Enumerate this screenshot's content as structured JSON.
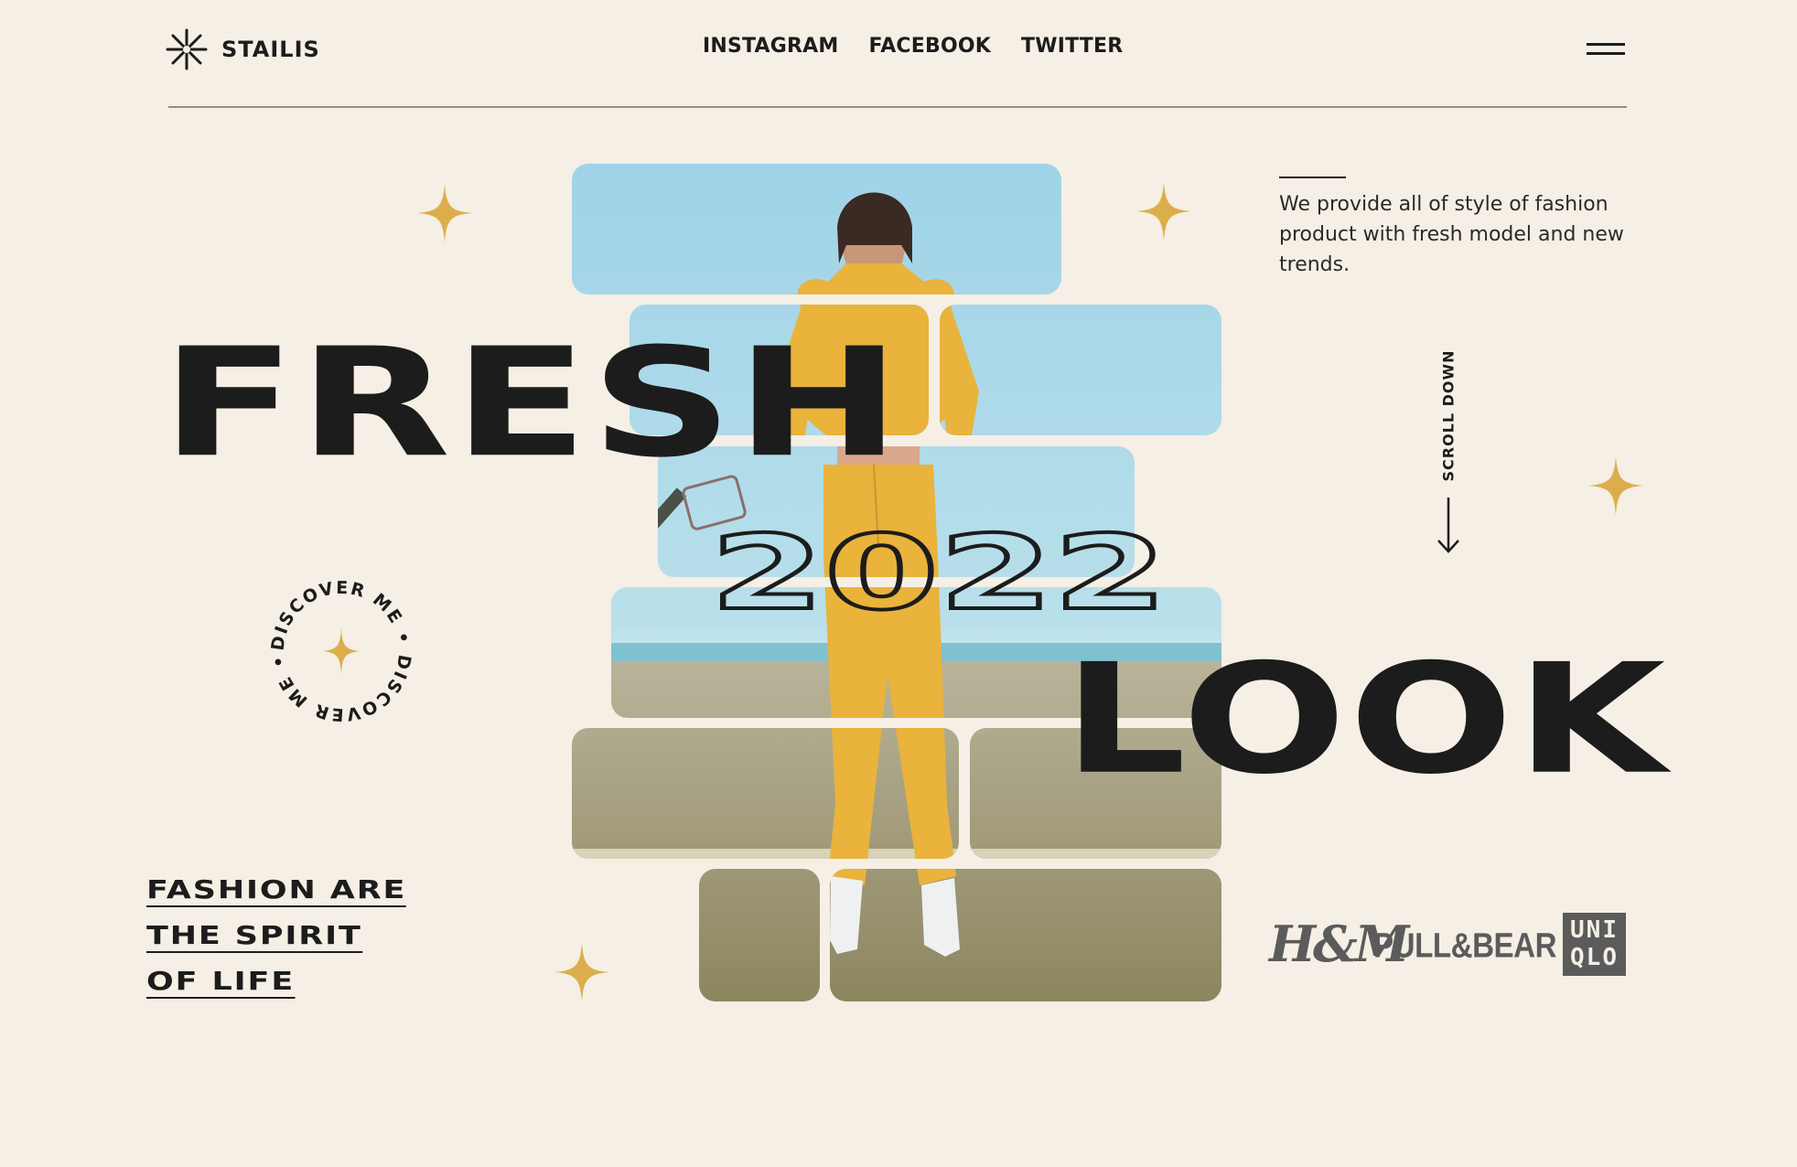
{
  "header": {
    "brand": "STAILIS",
    "nav": [
      "INSTAGRAM",
      "FACEBOOK",
      "TWITTER"
    ]
  },
  "hero": {
    "word1": "FRESH",
    "year": "2022",
    "word2": "LOOK"
  },
  "description": "We provide all of style of fashion product with fresh model and new trends.",
  "scroll_label": "SCROLL DOWN",
  "badge_text": "DISCOVER ME • DISCOVER ME •",
  "tagline": [
    "FASHION ARE",
    "THE SPIRIT",
    "OF LIFE"
  ],
  "brands": {
    "hm": "H&M",
    "pullbear": "PULL&BEAR",
    "uniqlo_line1": "UNI",
    "uniqlo_line2": "QLO"
  },
  "colors": {
    "background": "#f5efe5",
    "text": "#1c1c1c",
    "accent_star": "#dcae4b",
    "outfit_yellow": "#e9b33c",
    "sky": "#a9d8ea"
  }
}
